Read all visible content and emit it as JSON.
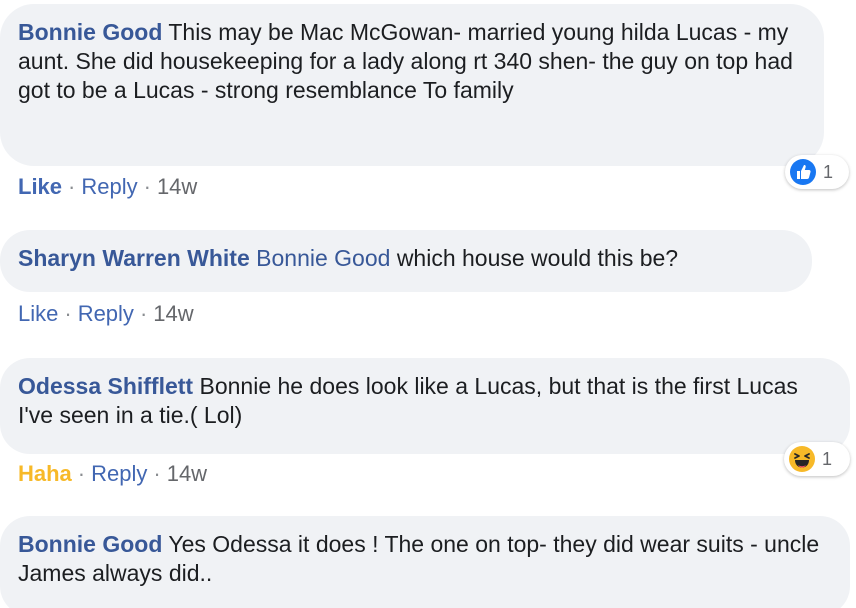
{
  "comments": [
    {
      "author": "Bonnie Good",
      "text": "This may be Mac McGowan- married young hilda Lucas - my aunt. She did housekeeping for a lady along rt 340 shen- the guy on top had got to be a Lucas - strong resemblance To family",
      "actions": {
        "reaction_label": "Like",
        "reply_label": "Reply",
        "time": "14w"
      },
      "reaction": {
        "icon": "like-thumb-icon",
        "count": "1"
      }
    },
    {
      "author": "Sharyn Warren White",
      "mention": "Bonnie Good",
      "text": "which house would this be?",
      "actions": {
        "reaction_label": "Like",
        "reply_label": "Reply",
        "time": "14w"
      }
    },
    {
      "author": "Odessa Shifflett",
      "text": "Bonnie he does look like a Lucas, but that is the first Lucas I've seen in a tie.( Lol)",
      "actions": {
        "reaction_label": "Haha",
        "reply_label": "Reply",
        "time": "14w"
      },
      "reaction": {
        "icon": "haha-face-icon",
        "count": "1"
      }
    },
    {
      "author": "Bonnie Good",
      "text": "Yes Odessa it does ! The one on top- they did wear suits - uncle James always did.."
    }
  ],
  "separator": "·",
  "colors": {
    "bubble": "#f0f2f5",
    "author": "#385898",
    "like": "#4267b2",
    "haha": "#f7b928",
    "meta": "#65676b"
  }
}
